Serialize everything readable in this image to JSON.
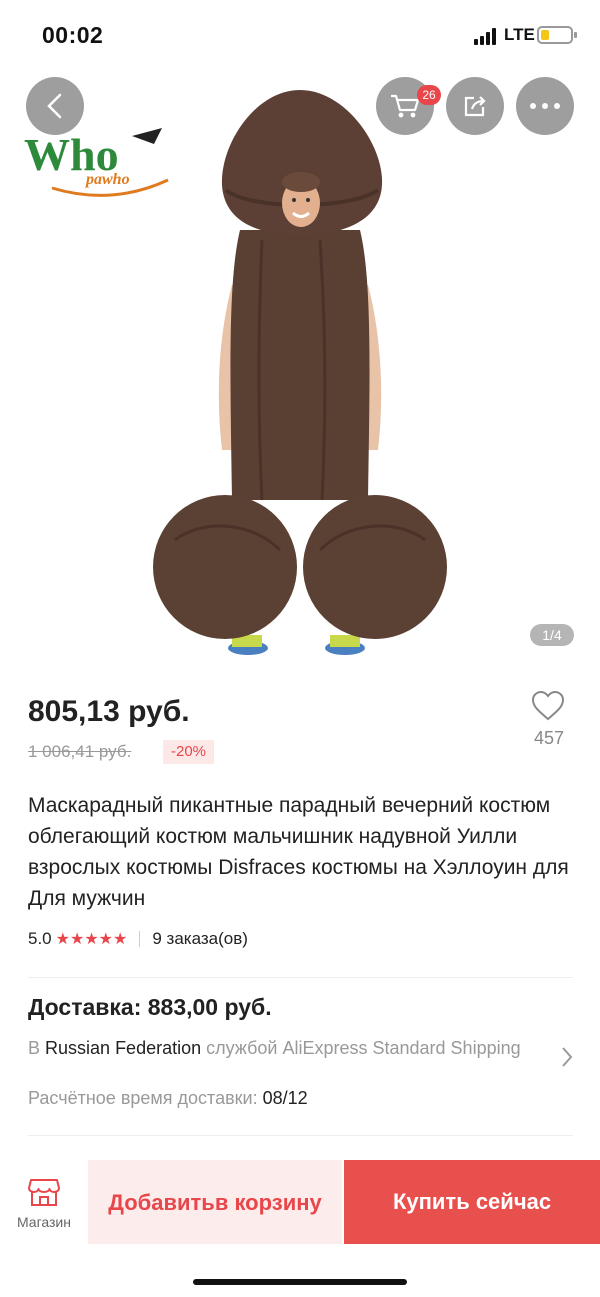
{
  "status_bar": {
    "time": "00:02",
    "network": "LTE"
  },
  "header": {
    "cart_badge": "26",
    "icons": {
      "back": "chevron-left-icon",
      "cart": "cart-icon",
      "share": "share-icon",
      "more": "more-dots-icon"
    }
  },
  "gallery": {
    "image_subject": "inflatable brown costume",
    "brand_logo_text": [
      "Who",
      "pawho"
    ],
    "page_indicator": "1/4"
  },
  "product": {
    "price": "805,13 руб.",
    "old_price": "1 006,41 руб.",
    "discount": "-20%",
    "wishlist_count": "457",
    "title": "Маскарадный пикантные парадный вечерний костюм облегающий костюм мальчишник надувной Уилли взрослых костюмы Disfraces костюмы на Хэллоуин для Для мужчин",
    "rating": "5.0",
    "stars": "★★★★★",
    "orders": "9 заказа(ов)"
  },
  "delivery": {
    "title": "Доставка: 883,00 руб.",
    "prefix": "В",
    "country": "Russian Federation",
    "service": "службой AliExpress Standard Shipping",
    "eta_label": "Расчётное время доставки:",
    "eta_value": "08/12"
  },
  "bottom_bar": {
    "shop_label": "Магазин",
    "add_to_cart": "Добавить в корзину",
    "buy_now": "Купить сейчас"
  },
  "colors": {
    "accent": "#e8464a",
    "buy_button": "#e8504d",
    "add_cart_bg": "#fdecec"
  }
}
